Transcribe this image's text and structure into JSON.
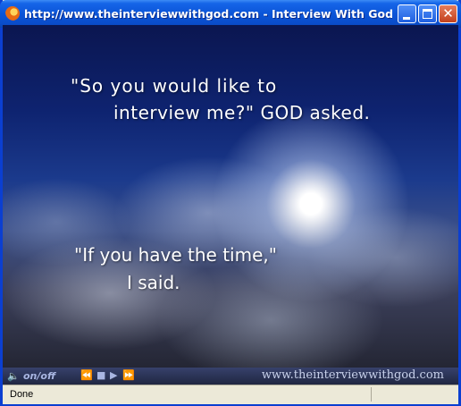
{
  "window": {
    "title": "http://www.theinterviewwithgod.com - Interview With God - Mo...",
    "close_glyph": "✕"
  },
  "content": {
    "quote1_line1": "\"So you would like to",
    "quote1_line2": "interview me?\" GOD asked.",
    "quote2_line1": "\"If you have the time,\"",
    "quote2_line2": "I said."
  },
  "player": {
    "sound_toggle_label": "on/off",
    "rewind_glyph": "⏪",
    "stop_glyph": "■",
    "play_glyph": "▶",
    "forward_glyph": "⏩",
    "speaker_glyph": "🔈",
    "site_label": "www.theinterviewwithgod.com"
  },
  "status": {
    "text": "Done"
  }
}
